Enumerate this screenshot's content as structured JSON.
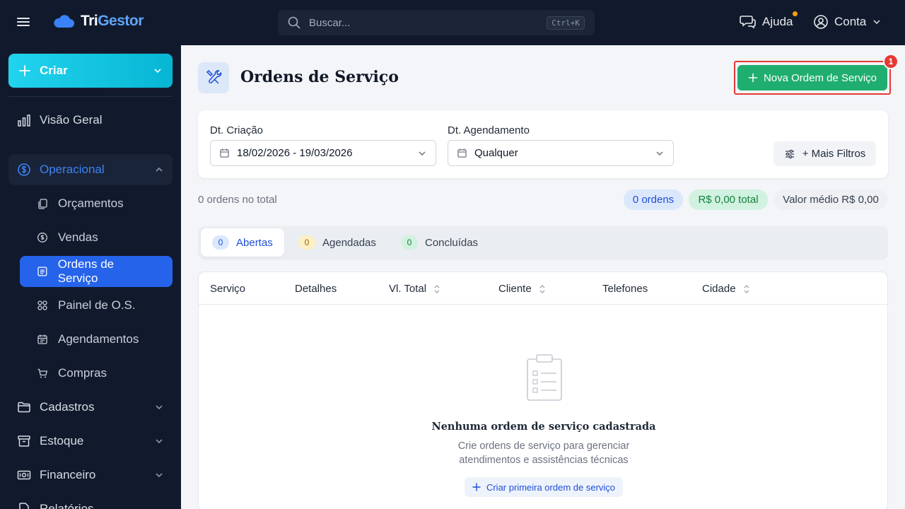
{
  "topbar": {
    "logo_a": "Tri",
    "logo_b": "Gestor",
    "search_placeholder": "Buscar...",
    "search_shortcut": "Ctrl+K",
    "help_label": "Ajuda",
    "account_label": "Conta"
  },
  "sidebar": {
    "create_label": "Criar",
    "items": [
      {
        "label": "Visão Geral"
      },
      {
        "label": "Operacional"
      },
      {
        "label": "Cadastros"
      },
      {
        "label": "Estoque"
      },
      {
        "label": "Financeiro"
      },
      {
        "label": "Relatórios"
      }
    ],
    "sub_items": [
      {
        "label": "Orçamentos"
      },
      {
        "label": "Vendas"
      },
      {
        "label": "Ordens de Serviço"
      },
      {
        "label": "Painel de O.S."
      },
      {
        "label": "Agendamentos"
      },
      {
        "label": "Compras"
      }
    ]
  },
  "page": {
    "title": "Ordens de Serviço",
    "new_button": "Nova Ordem de Serviço",
    "notification_count": "1"
  },
  "filters": {
    "created_label": "Dt. Criação",
    "created_value": "18/02/2026 - 19/03/2026",
    "scheduled_label": "Dt. Agendamento",
    "scheduled_value": "Qualquer",
    "more_filters": "+ Mais Filtros"
  },
  "summary": {
    "total_text": "0 ordens no total",
    "orders_chip": "0 ordens",
    "total_chip": "R$ 0,00 total",
    "average_chip": "Valor médio R$ 0,00"
  },
  "tabs": [
    {
      "count": "0",
      "label": "Abertas"
    },
    {
      "count": "0",
      "label": "Agendadas"
    },
    {
      "count": "0",
      "label": "Concluídas"
    }
  ],
  "table": {
    "columns": [
      "Serviço",
      "Detalhes",
      "Vl. Total",
      "Cliente",
      "Telefones",
      "Cidade"
    ]
  },
  "empty": {
    "title": "Nenhuma ordem de serviço cadastrada",
    "desc_line1": "Crie ordens de serviço para gerenciar",
    "desc_line2": "atendimentos e assistências técnicas",
    "button": "Criar primeira ordem de serviço"
  },
  "colors": {
    "topbar_bg": "#111a2c",
    "accent_blue": "#2563eb",
    "create_cyan": "#06b6d4",
    "primary_green": "#1fae6f",
    "highlight_red": "#e53935"
  }
}
